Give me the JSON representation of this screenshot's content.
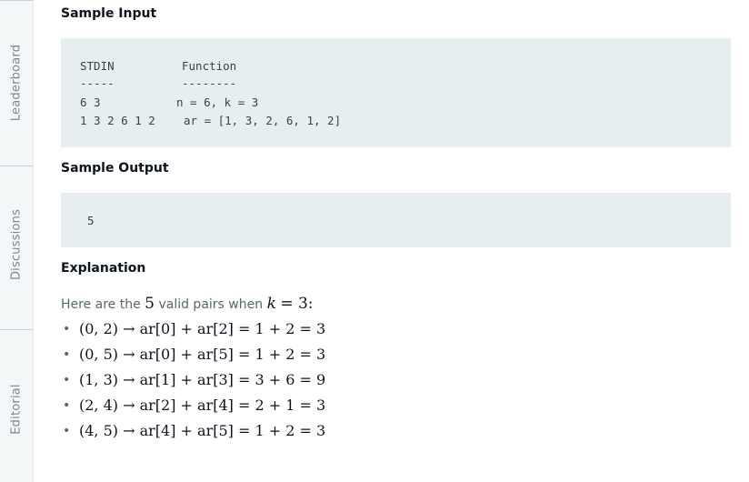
{
  "sidebar": {
    "tabs": [
      {
        "label": "Leaderboard"
      },
      {
        "label": "Discussions"
      },
      {
        "label": "Editorial"
      }
    ]
  },
  "sample_input": {
    "heading": "Sample Input",
    "lines": [
      {
        "left": "STDIN",
        "right": "Function"
      },
      {
        "left": "-----",
        "right": "--------"
      },
      {
        "left": "6 3",
        "right": "n = 6, k = 3"
      },
      {
        "left": "1 3 2 6 1 2",
        "right": "ar = [1, 3, 2, 6, 1, 2]"
      }
    ]
  },
  "sample_output": {
    "heading": "Sample Output",
    "value": "5"
  },
  "explanation": {
    "heading": "Explanation",
    "intro_prefix": "Here are the",
    "count": "5",
    "intro_middle": "valid pairs when",
    "k_var": "k",
    "k_value": "= 3:",
    "pairs": [
      "(0, 2) → ar[0] + ar[2] = 1 + 2 = 3",
      "(0, 5) → ar[0] + ar[5] = 1 + 2 = 3",
      "(1, 3) → ar[1] + ar[3] = 3 + 6 = 9",
      "(2, 4) → ar[2] + ar[4] = 2 + 1 = 3",
      "(4, 5) → ar[4] + ar[5] = 1 + 2 = 3"
    ],
    "bullet": "•"
  }
}
